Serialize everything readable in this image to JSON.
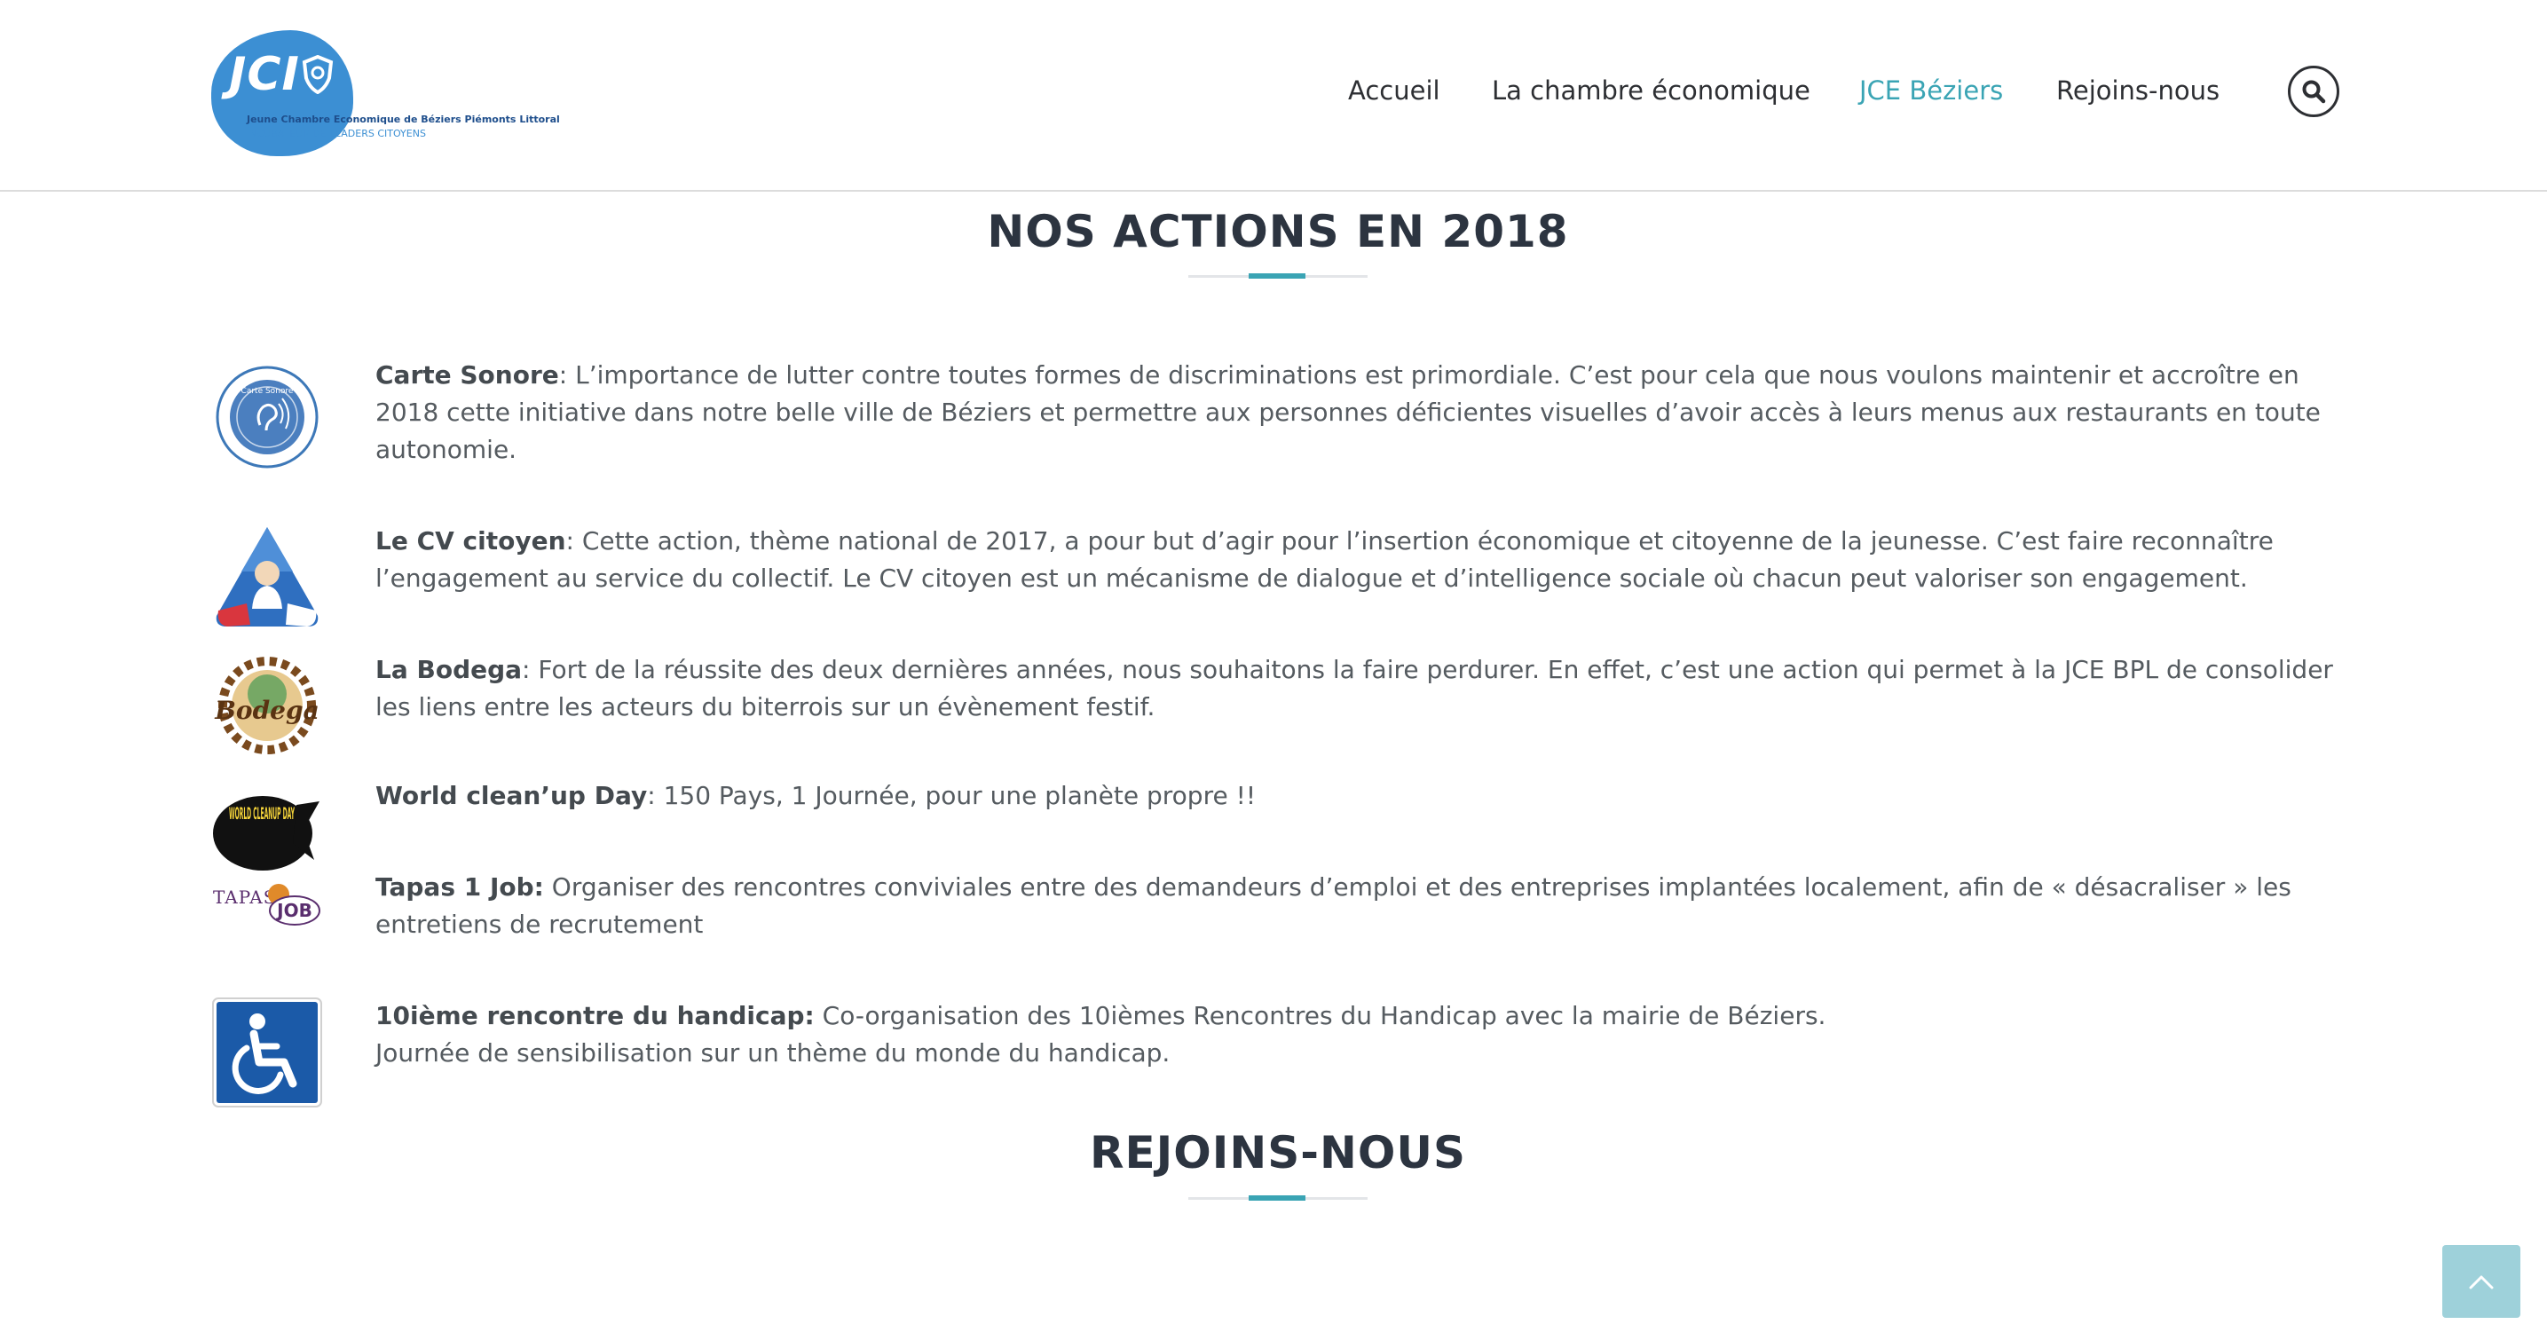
{
  "header": {
    "logo": {
      "text": "JCI",
      "subtitle": "Jeune Chambre Economique de Béziers Piémonts Littoral",
      "tagline": "INCUBATEUR DE LEADERS CITOYENS"
    },
    "nav": [
      {
        "label": "Accueil"
      },
      {
        "label": "La chambre économique"
      },
      {
        "label": "JCE Béziers",
        "active": true
      },
      {
        "label": "Rejoins-nous"
      }
    ],
    "search_icon": "search-icon",
    "accent_color": "#3aa4b4"
  },
  "sections": {
    "actions_title": "NOS ACTIONS EN 2018",
    "join_title": "REJOINS-NOUS"
  },
  "actions": [
    {
      "icon": "carte-sonore-logo",
      "icon_text": "Carte Sonore",
      "title": "Carte Sonore",
      "separator": ":",
      "text": " L’importance de lutter contre toutes formes de discriminations est primordiale. C’est pour cela que nous voulons maintenir et accroître en 2018 cette initiative dans notre belle ville de Béziers et permettre aux personnes déficientes visuelles d’avoir accès à leurs menus aux restaurants en toute autonomie."
    },
    {
      "icon": "cv-citoyen-logo",
      "title": "Le CV citoyen",
      "separator": ":",
      "text": " Cette action, thème national de 2017, a pour but d’agir pour l’insertion économique et citoyenne de la jeunesse. C’est faire reconnaître l’engagement au service du collectif. Le CV citoyen est un mécanisme de dialogue et d’intelligence sociale où chacun peut valoriser son engagement."
    },
    {
      "icon": "bodega-logo",
      "icon_text": "Bodega",
      "title": "La Bodega",
      "separator": ":",
      "text": " Fort de la réussite des deux dernières années, nous souhaitons la faire perdurer. En effet, c’est une action qui permet à la JCE BPL de consolider les liens entre les acteurs du biterrois sur un évènement festif."
    },
    {
      "icon": "world-cleanup-day-logo",
      "icon_text": "WORLD CLEANUP DAY",
      "title": "World clean’up Day",
      "separator": ":",
      "text": " 150 Pays, 1 Journée, pour une planète propre !!"
    },
    {
      "icon": "tapas-1-job-logo",
      "icon_text_1": "TAPAS",
      "icon_text_2": "JOB",
      "title": "Tapas 1 Job:",
      "separator": "",
      "text": " Organiser des rencontres conviviales entre des demandeurs d’emploi et des entreprises implantées localement, afin de « désacraliser » les entretiens de recrutement"
    },
    {
      "icon": "wheelchair-icon",
      "title": "10ième rencontre du handicap:",
      "separator": "",
      "text": " Co-organisation des 10ièmes Rencontres du Handicap avec la mairie de Béziers.",
      "text_line2": "Journée de sensibilisation sur un thème du monde du handicap."
    }
  ],
  "back_to_top_icon": "chevron-up-icon"
}
